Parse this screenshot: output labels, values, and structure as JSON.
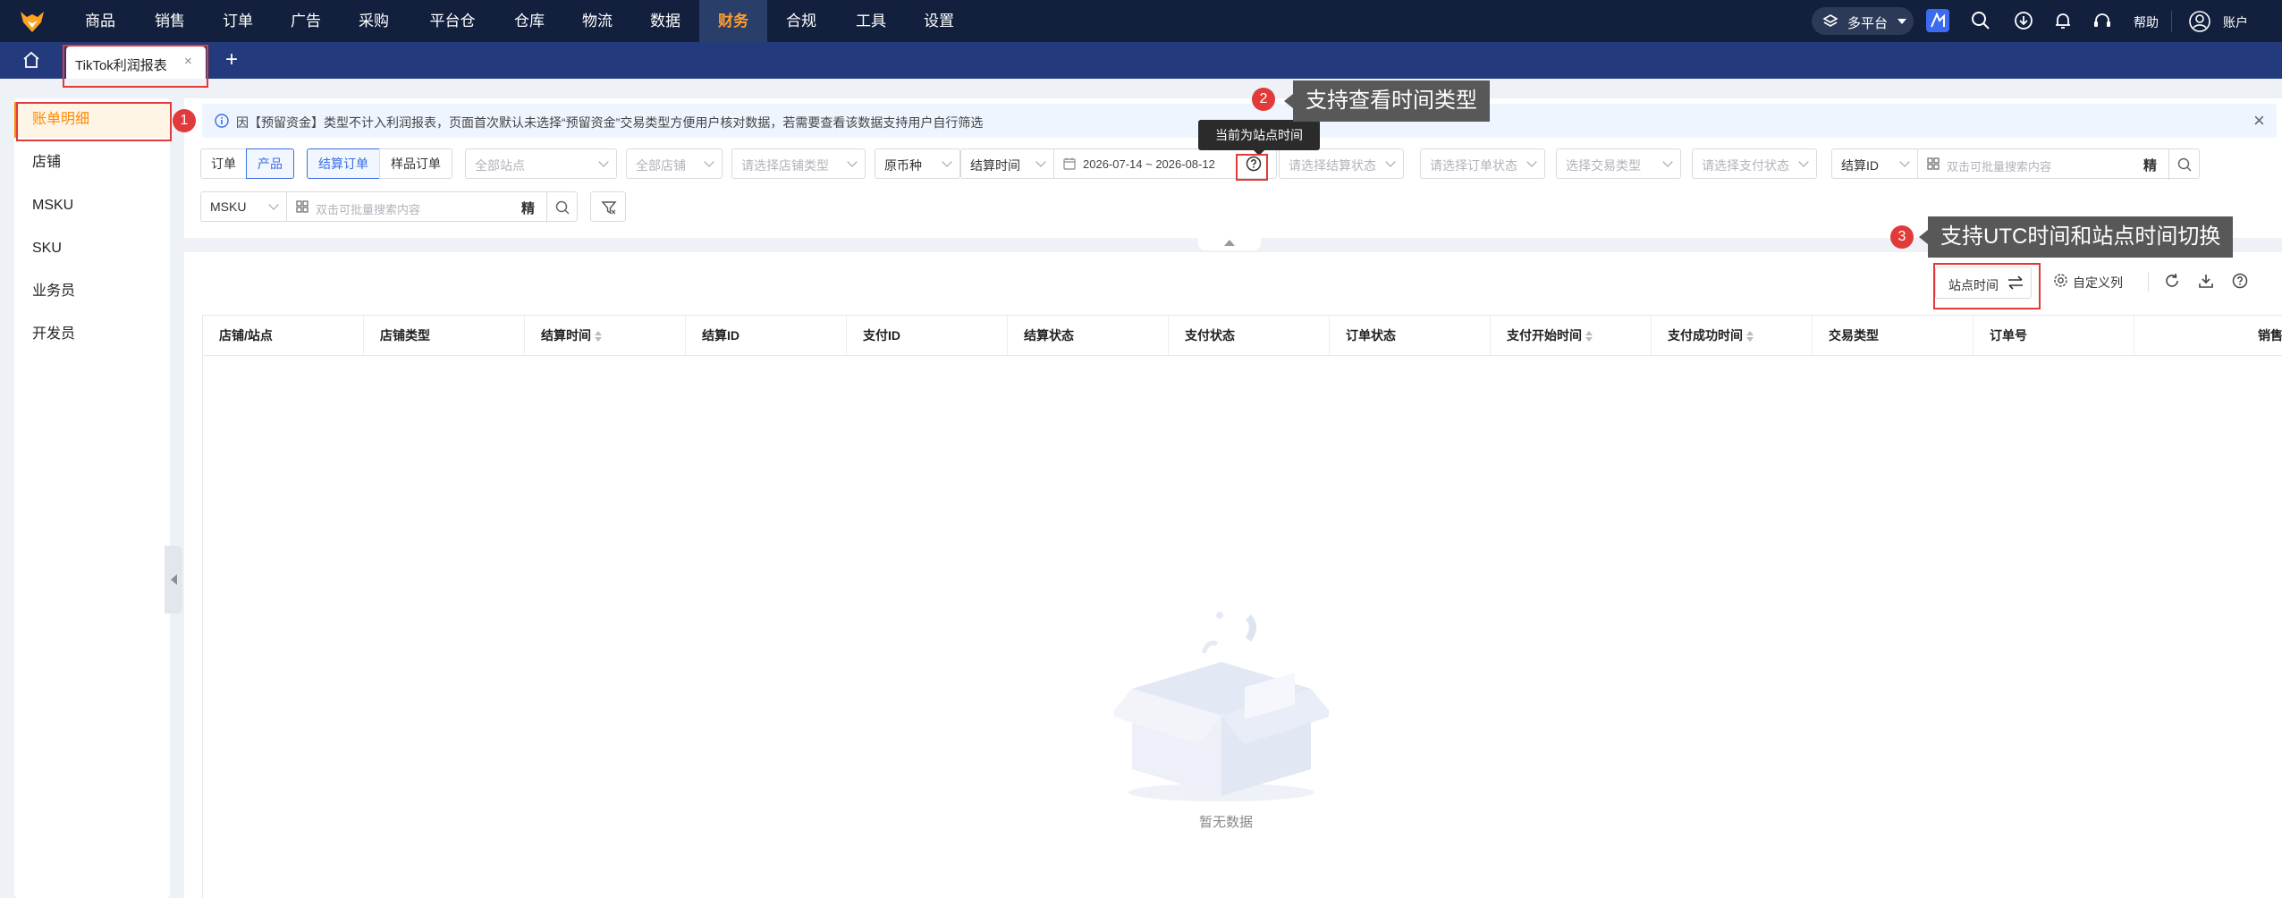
{
  "nav": {
    "items": [
      "商品",
      "销售",
      "订单",
      "广告",
      "采购",
      "平台仓",
      "仓库",
      "物流",
      "数据",
      "财务",
      "合规",
      "工具",
      "设置"
    ],
    "active_index": 9,
    "platform_label": "多平台",
    "help_label": "帮助",
    "account_label": "账户",
    "accent_color": "#ff9d2b"
  },
  "tabs": {
    "home_icon": "home-icon",
    "current": "TikTok利润报表",
    "close_glyph": "×",
    "add_glyph": "+"
  },
  "sidebar": {
    "items": [
      "账单明细",
      "店铺",
      "MSKU",
      "SKU",
      "业务员",
      "开发员"
    ],
    "active_index": 0
  },
  "notice": {
    "text": "因【预留资金】类型不计入利润报表，页面首次默认未选择“预留资金”交易类型方便用户核对数据，若需要查看该数据支持用户自行筛选",
    "close_glyph": "×"
  },
  "filters": {
    "dim_tabs": [
      "订单",
      "产品"
    ],
    "dim_active": 1,
    "order_tabs": [
      "结算订单",
      "样品订单"
    ],
    "order_active": 0,
    "site_placeholder": "全部站点",
    "shop_placeholder": "全部店铺",
    "shop_type_placeholder": "请选择店铺类型",
    "currency": "原币种",
    "time_type": "结算时间",
    "date_range": "2026-07-14 ~ 2026-08-12",
    "time_tooltip": "当前为站点时间",
    "settle_status_placeholder": "请选择结算状态",
    "order_status_placeholder": "请选择订单状态",
    "txn_type_placeholder": "选择交易类型",
    "pay_status_placeholder": "请选择支付状态",
    "search1_field": "结算ID",
    "search1_placeholder": "双击可批量搜索内容",
    "exact_label": "精",
    "search2_field": "MSKU",
    "search2_placeholder": "双击可批量搜索内容"
  },
  "toolbar": {
    "site_time_label": "站点时间",
    "custom_cols_label": "自定义列"
  },
  "table": {
    "columns": [
      "店铺/站点",
      "店铺类型",
      "结算时间",
      "结算ID",
      "支付ID",
      "结算状态",
      "支付状态",
      "订单状态",
      "支付开始时间",
      "支付成功时间",
      "交易类型",
      "订单号",
      "销售"
    ],
    "sortable": [
      false,
      false,
      true,
      false,
      false,
      false,
      false,
      false,
      true,
      true,
      false,
      false,
      false
    ],
    "empty_text": "暂无数据"
  },
  "annotations": {
    "n1": "1",
    "n2": "2",
    "n3": "3",
    "callout2": "支持查看时间类型",
    "callout3": "支持UTC时间和站点时间切换",
    "highlight_color": "#e03a3a"
  }
}
